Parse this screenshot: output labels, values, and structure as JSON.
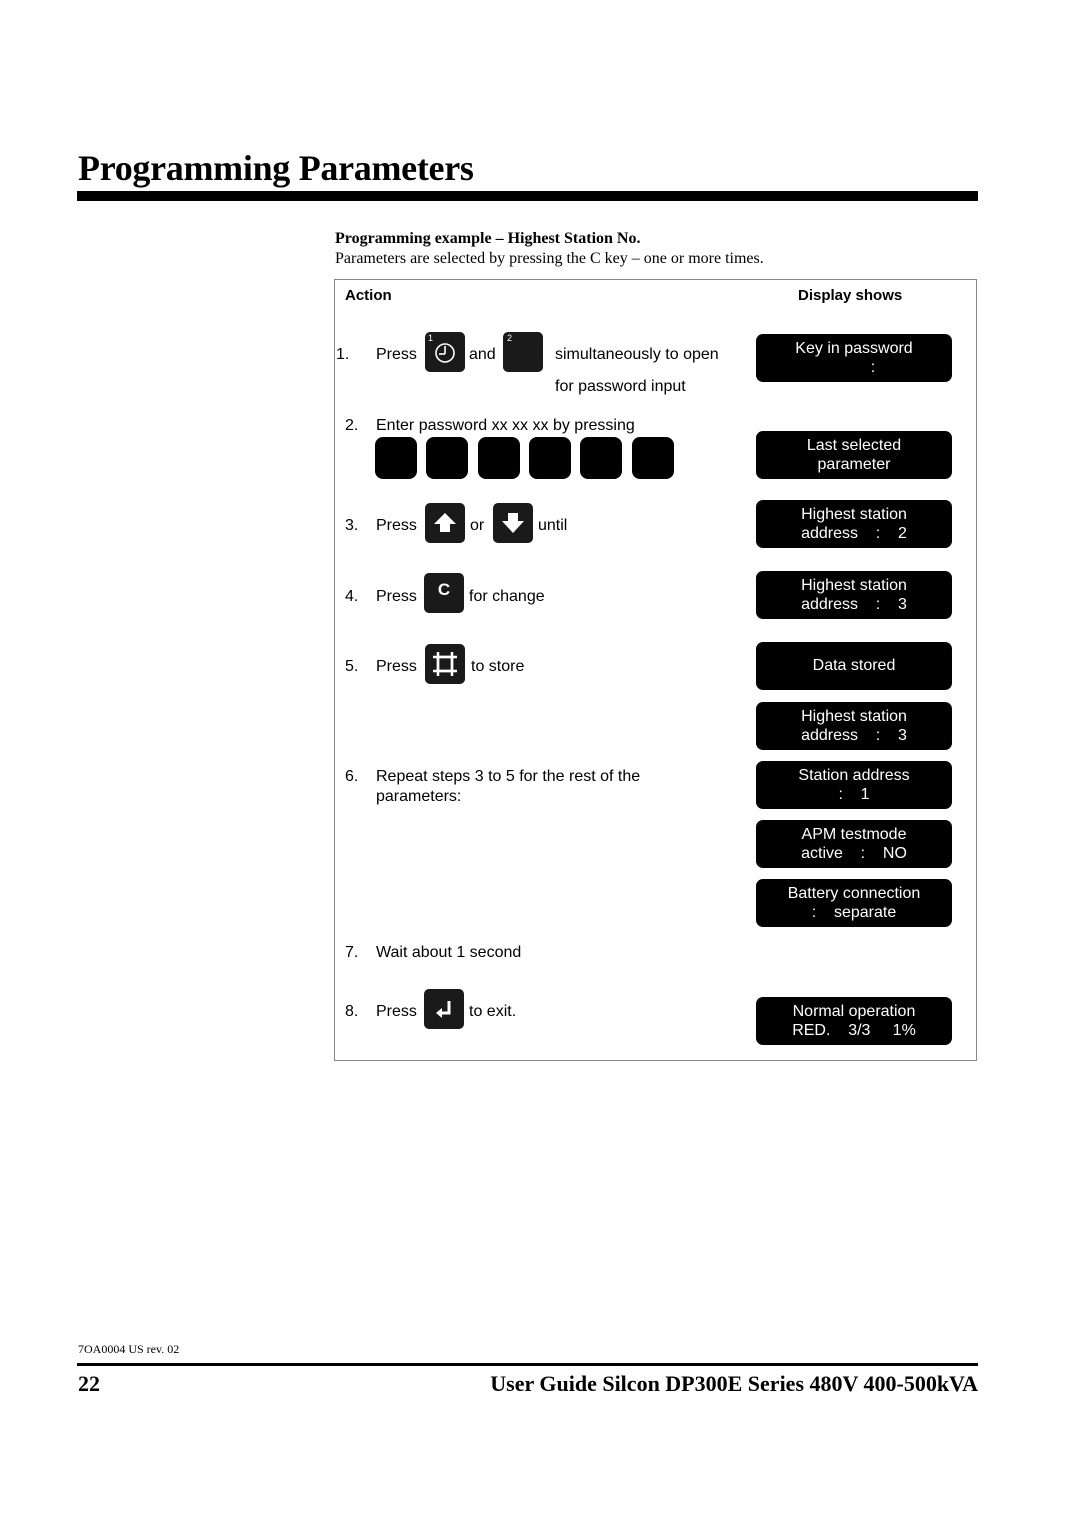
{
  "page": {
    "title": "Programming Parameters",
    "footer_code": "7OA0004 US rev. 02",
    "page_number": "22",
    "guide_title": "User Guide Silcon DP300E Series 480V 400-500kVA"
  },
  "section": {
    "heading": "Programming example – Highest Station No.",
    "intro": "Parameters are selected by pressing the C key – one or more times."
  },
  "table": {
    "col_action": "Action",
    "col_display": "Display shows",
    "steps": [
      {
        "num": "1.",
        "press": "Press",
        "and": "and",
        "text": "simultaneously to open",
        "text2": "for password input",
        "key1_label": "1",
        "key2_label": "2",
        "key1_icon": "clock-icon"
      },
      {
        "num": "2.",
        "text": "Enter password xx xx xx by pressing"
      },
      {
        "num": "3.",
        "press": "Press",
        "or": "or",
        "text": "until",
        "key1_icon": "arrow-up-icon",
        "key2_icon": "arrow-down-icon"
      },
      {
        "num": "4.",
        "press": "Press",
        "text": "for change",
        "key_label": "C"
      },
      {
        "num": "5.",
        "press": "Press",
        "text": "to store",
        "key_icon": "store-icon"
      },
      {
        "num": "6.",
        "text": "Repeat steps 3 to 5 for the rest of the",
        "text2": "parameters:"
      },
      {
        "num": "7.",
        "text": "Wait about 1 second"
      },
      {
        "num": "8.",
        "press": "Press",
        "text": "to exit.",
        "key_icon": "enter-icon"
      }
    ],
    "displays": [
      {
        "line1": "Key in password",
        "line2": ":"
      },
      {
        "line1": "Last selected",
        "line2": "parameter"
      },
      {
        "line1": "Highest station",
        "line2": "address    :    2"
      },
      {
        "line1": "Highest station",
        "line2": "address    :    3"
      },
      {
        "line1": "Data stored",
        "line2": ""
      },
      {
        "line1": "Highest station",
        "line2": "address    :    3"
      },
      {
        "line1": "Station address",
        "line2": ":    1"
      },
      {
        "line1": "APM testmode",
        "line2": "active    :    NO"
      },
      {
        "line1": "Battery connection",
        "line2": ":    separate"
      },
      {
        "line1": "Normal operation",
        "line2": "RED.    3/3     1%"
      }
    ]
  }
}
